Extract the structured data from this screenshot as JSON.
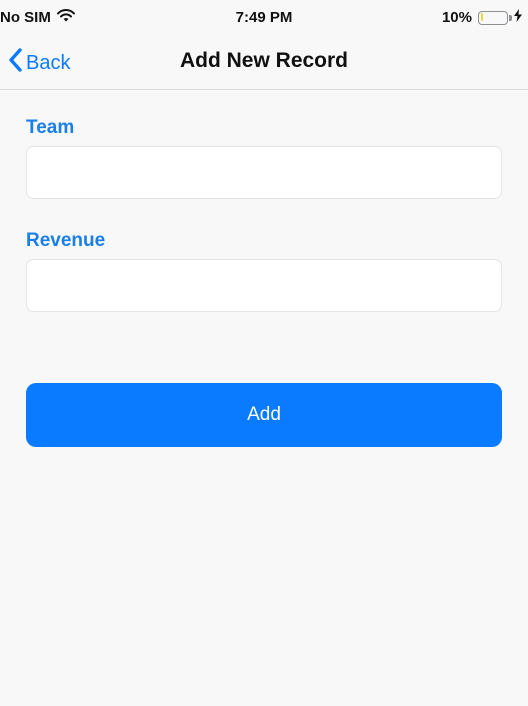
{
  "status_bar": {
    "carrier": "No SIM",
    "time": "7:49 PM",
    "battery_percent": "10%",
    "battery_level": 0.1,
    "battery_color": "#f5d33b",
    "icons": [
      "wifi-icon",
      "battery-icon",
      "charging-bolt-icon"
    ]
  },
  "nav_bar": {
    "back_label": "Back",
    "title": "Add New Record",
    "accent_color": "#0a7bff"
  },
  "form": {
    "fields": [
      {
        "label": "Team",
        "value": "",
        "placeholder": ""
      },
      {
        "label": "Revenue",
        "value": "",
        "placeholder": ""
      }
    ],
    "submit_label": "Add",
    "label_color": "#1a7fe6",
    "button_color": "#0a7bff"
  }
}
